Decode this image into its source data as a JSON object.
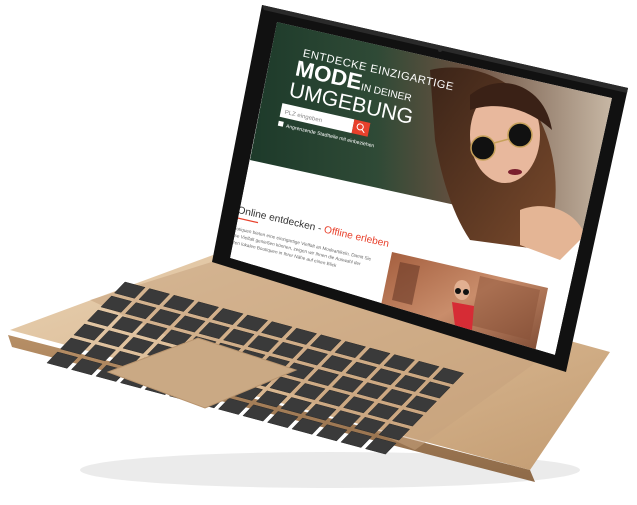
{
  "hero": {
    "line1": "ENTDECKE EINZIGARTIGE",
    "mode": "MODE",
    "in_deiner": "IN DEINER",
    "umgebung": "UMGEBUNG",
    "plz_placeholder": "PLZ eingeben",
    "checkbox_label": "Angrenzende Stadtteile mit einbeziehen"
  },
  "section": {
    "heading_part1": "Online entdecken - ",
    "heading_part2": "Offline erleben",
    "paragraph_lines": [
      "Boutiquen bieten eine einzigartige Vielfalt an Modeartikeln. Damit Sie",
      "diese Vielfalt genießen können, zeigen wir Ihnen die Auswahl der",
      "besten lokalen Boutiquen in Ihrer Nähe auf einen Blick"
    ]
  },
  "colors": {
    "accent": "#e8412c",
    "laptop_body": "#d8b892",
    "bezel": "#1b1b1b",
    "key": "#3a3a3a"
  },
  "icons": [
    "search-icon",
    "checkbox-icon",
    "camera-icon"
  ]
}
